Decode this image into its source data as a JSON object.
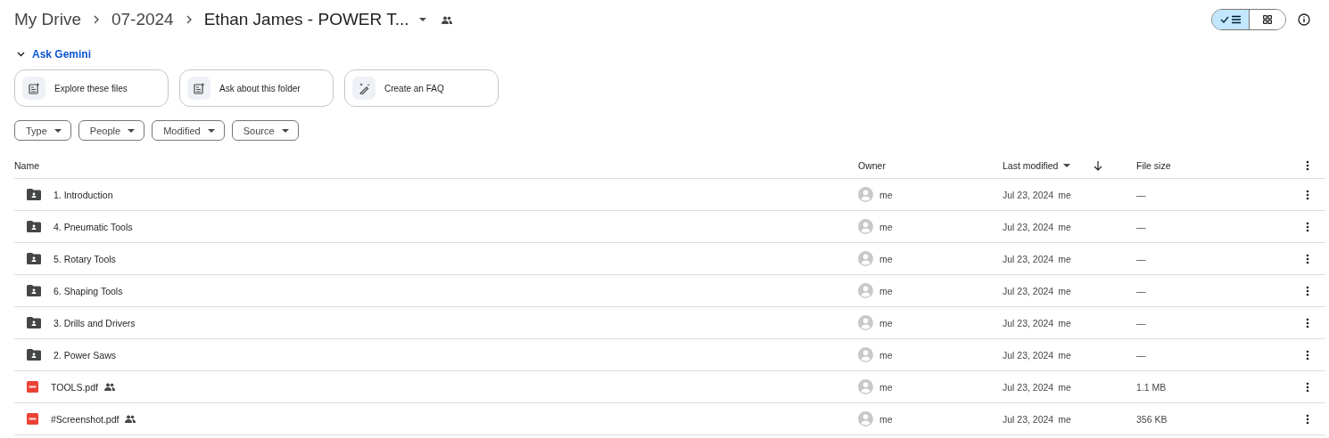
{
  "breadcrumb": [
    "My Drive",
    "07-2024",
    "Ethan James - POWER T..."
  ],
  "view_toggle": [
    {
      "kind": "list",
      "selected": true
    },
    {
      "kind": "grid",
      "selected": false
    }
  ],
  "ask_gemini": {
    "label": "Ask Gemini",
    "expanded": true
  },
  "suggestions": [
    {
      "kind": "files",
      "label": "Explore these files"
    },
    {
      "kind": "files",
      "label": "Ask about this folder"
    },
    {
      "kind": "wand",
      "label": "Create an FAQ"
    }
  ],
  "filters": [
    "Type",
    "People",
    "Modified",
    "Source"
  ],
  "table": {
    "columns": [
      "Name",
      "Owner",
      "Last modified",
      "File size"
    ],
    "rows": [
      {
        "kind": "folder",
        "name": "1. Introduction",
        "shared": false,
        "owner": "me",
        "modified": "Jul 23, 2024",
        "modified_by": "me",
        "size": "—"
      },
      {
        "kind": "folder",
        "name": "4. Pneumatic Tools",
        "shared": false,
        "owner": "me",
        "modified": "Jul 23, 2024",
        "modified_by": "me",
        "size": "—"
      },
      {
        "kind": "folder",
        "name": "5. Rotary Tools",
        "shared": false,
        "owner": "me",
        "modified": "Jul 23, 2024",
        "modified_by": "me",
        "size": "—"
      },
      {
        "kind": "folder",
        "name": "6. Shaping Tools",
        "shared": false,
        "owner": "me",
        "modified": "Jul 23, 2024",
        "modified_by": "me",
        "size": "—"
      },
      {
        "kind": "folder",
        "name": "3. Drills and Drivers",
        "shared": false,
        "owner": "me",
        "modified": "Jul 23, 2024",
        "modified_by": "me",
        "size": "—"
      },
      {
        "kind": "folder",
        "name": "2. Power Saws",
        "shared": false,
        "owner": "me",
        "modified": "Jul 23, 2024",
        "modified_by": "me",
        "size": "—"
      },
      {
        "kind": "pdf",
        "name": "TOOLS.pdf",
        "shared": true,
        "owner": "me",
        "modified": "Jul 23, 2024",
        "modified_by": "me",
        "size": "1.1 MB"
      },
      {
        "kind": "pdf",
        "name": "#Screenshot.pdf",
        "shared": true,
        "owner": "me",
        "modified": "Jul 23, 2024",
        "modified_by": "me",
        "size": "356 KB"
      }
    ]
  }
}
